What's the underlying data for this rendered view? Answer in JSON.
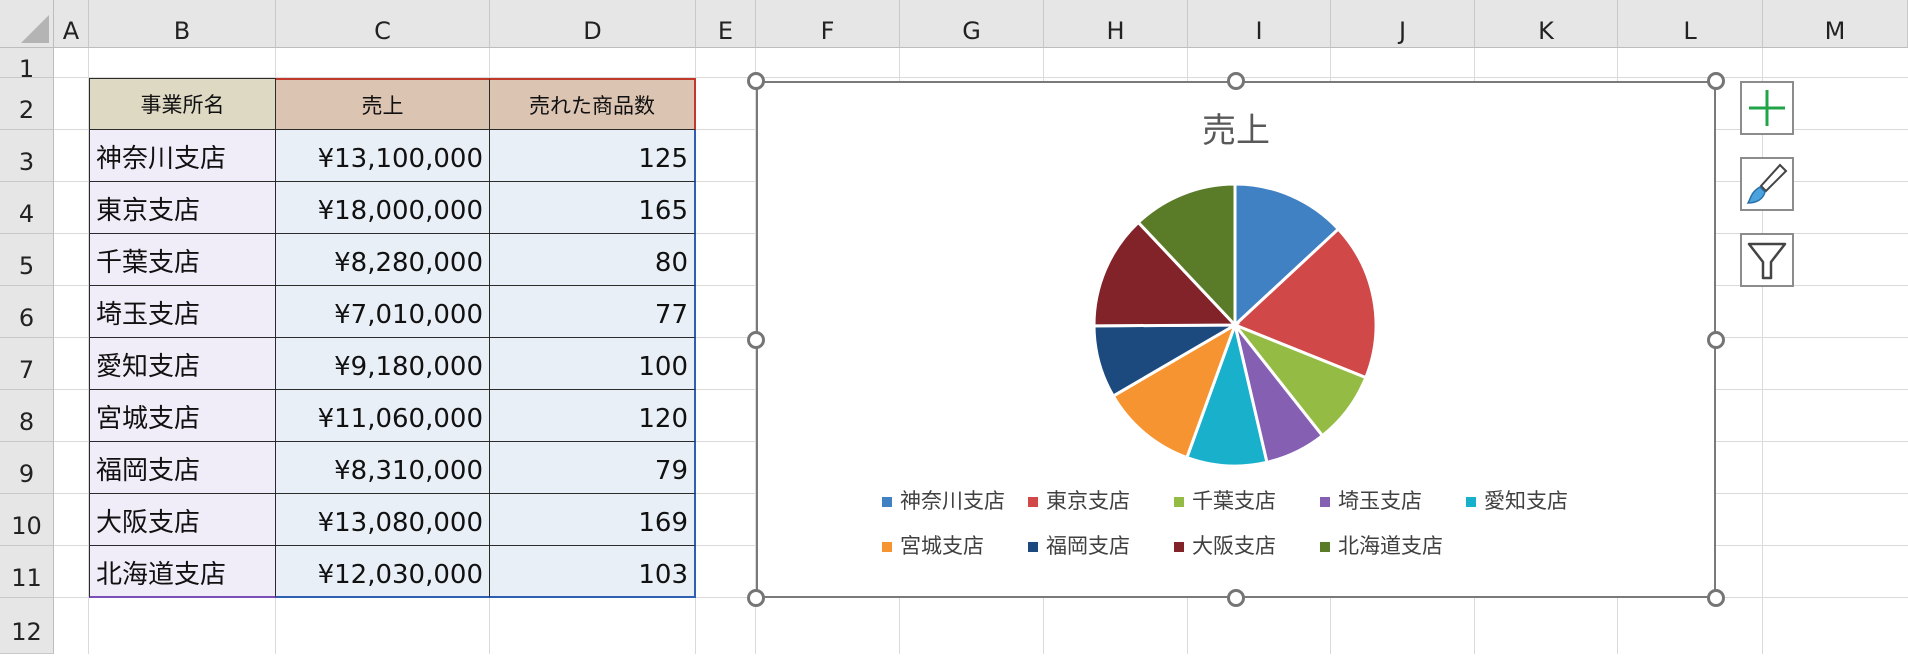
{
  "columns": [
    "A",
    "B",
    "C",
    "D",
    "E",
    "F",
    "G",
    "H",
    "I",
    "J",
    "K",
    "L",
    "M"
  ],
  "rows": [
    "1",
    "2",
    "3",
    "4",
    "5",
    "6",
    "7",
    "8",
    "9",
    "10",
    "11",
    "12"
  ],
  "table": {
    "headers": [
      "事業所名",
      "売上",
      "売れた商品数"
    ],
    "rows": [
      [
        "神奈川支店",
        "¥13,100,000",
        "125"
      ],
      [
        "東京支店",
        "¥18,000,000",
        "165"
      ],
      [
        "千葉支店",
        "¥8,280,000",
        "80"
      ],
      [
        "埼玉支店",
        "¥7,010,000",
        "77"
      ],
      [
        "愛知支店",
        "¥9,180,000",
        "100"
      ],
      [
        "宮城支店",
        "¥11,060,000",
        "120"
      ],
      [
        "福岡支店",
        "¥8,310,000",
        "79"
      ],
      [
        "大阪支店",
        "¥13,080,000",
        "169"
      ],
      [
        "北海道支店",
        "¥12,030,000",
        "103"
      ]
    ]
  },
  "chart_data": {
    "type": "pie",
    "title": "売上",
    "categories": [
      "神奈川支店",
      "東京支店",
      "千葉支店",
      "埼玉支店",
      "愛知支店",
      "宮城支店",
      "福岡支店",
      "大阪支店",
      "北海道支店"
    ],
    "values": [
      13100000,
      18000000,
      8280000,
      7010000,
      9180000,
      11060000,
      8310000,
      13080000,
      12030000
    ],
    "colors": [
      "#4081c4",
      "#d04848",
      "#94bb43",
      "#8560b2",
      "#19b0cc",
      "#f79432",
      "#1c4a7f",
      "#82232a",
      "#5a7b27"
    ],
    "legend_position": "bottom"
  },
  "side_buttons": {
    "add_element_icon": "plus-icon",
    "styles_icon": "paintbrush-icon",
    "filter_icon": "funnel-icon"
  }
}
